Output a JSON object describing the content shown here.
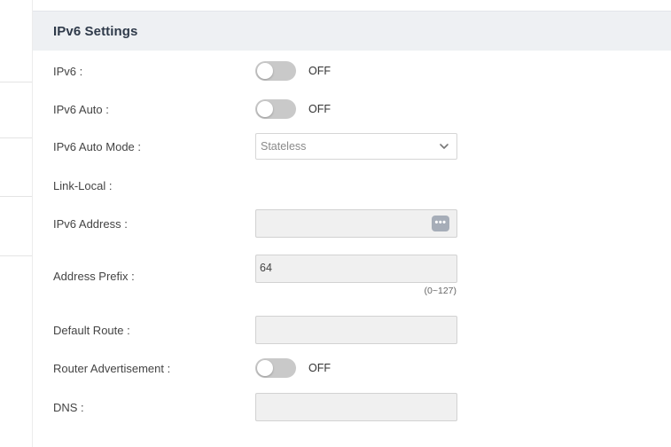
{
  "section": {
    "title": "IPv6 Settings"
  },
  "fields": {
    "ipv6": {
      "label": "IPv6 :",
      "state": "OFF",
      "enabled": false
    },
    "ipv6_auto": {
      "label": "IPv6 Auto :",
      "state": "OFF",
      "enabled": false
    },
    "ipv6_auto_mode": {
      "label": "IPv6 Auto Mode :",
      "value": "Stateless"
    },
    "link_local": {
      "label": "Link-Local :"
    },
    "ipv6_address": {
      "label": "IPv6 Address :",
      "value": "",
      "more_icon": "more-dots-icon"
    },
    "address_prefix": {
      "label": "Address Prefix :",
      "value": "64",
      "hint": "(0~127)"
    },
    "default_route": {
      "label": "Default Route :",
      "value": ""
    },
    "router_advertisement": {
      "label": "Router Advertisement :",
      "state": "OFF",
      "enabled": false
    },
    "dns": {
      "label": "DNS :",
      "value": ""
    }
  },
  "colors": {
    "header_bg": "#eef0f3",
    "toggle_off": "#c9c9c9",
    "input_bg": "#f0f0f0",
    "more_button": "#a6adb8"
  }
}
